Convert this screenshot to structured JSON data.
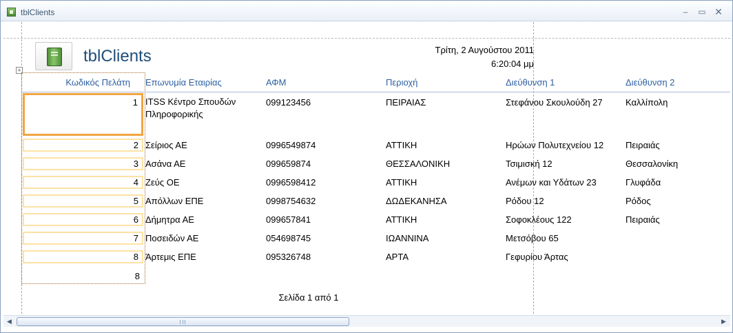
{
  "window": {
    "title": "tblClients",
    "min": "‒",
    "max": "▭",
    "close": "✕"
  },
  "report": {
    "title": "tblClients",
    "date": "Τρίτη, 2 Αυγούστου 2011",
    "time": "6:20:04 μμ",
    "columns": [
      "Κωδικός Πελάτη",
      "Επωνυμία Εταιρίας",
      "ΑΦΜ",
      "Περιοχή",
      "Διεύθυνση 1",
      "Διεύθυνση 2"
    ],
    "rows": [
      {
        "id": "1",
        "company": "ITSS Κέντρο Σπουδών Πληροφορικής",
        "afm": "099123456",
        "area": "ΠΕΙΡΑΙΑΣ",
        "address1": "Στεφάνου Σκουλούδη 27",
        "address2": "Καλλίπολη"
      },
      {
        "id": "2",
        "company": "Σείριος ΑΕ",
        "afm": "0996549874",
        "area": "ΑΤΤΙΚΗ",
        "address1": "Ηρώων Πολυτεχνείου 12",
        "address2": "Πειραιάς"
      },
      {
        "id": "3",
        "company": "Ασάνα ΑΕ",
        "afm": "099659874",
        "area": "ΘΕΣΣΑΛΟΝΙΚΗ",
        "address1": "Τσιμισκή 12",
        "address2": "Θεσσαλονίκη"
      },
      {
        "id": "4",
        "company": "Ζεύς ΟΕ",
        "afm": "0996598412",
        "area": "ΑΤΤΙΚΗ",
        "address1": "Ανέμων και Υδάτων 23",
        "address2": "Γλυφάδα"
      },
      {
        "id": "5",
        "company": "Απόλλων ΕΠΕ",
        "afm": "0998754632",
        "area": "ΔΩΔΕΚΑΝΗΣΑ",
        "address1": "Ρόδου 12",
        "address2": "Ρόδος"
      },
      {
        "id": "6",
        "company": "Δήμητρα ΑΕ",
        "afm": "099657841",
        "area": "ΑΤΤΙΚΗ",
        "address1": "Σοφοκλέους 122",
        "address2": "Πειραιάς"
      },
      {
        "id": "7",
        "company": "Ποσειδών ΑΕ",
        "afm": "054698745",
        "area": "ΙΩΑΝΝΙΝΑ",
        "address1": "Μετσόβου 65",
        "address2": ""
      },
      {
        "id": "8",
        "company": "Άρτεμις ΕΠΕ",
        "afm": "095326748",
        "area": "ΑΡΤΑ",
        "address1": "Γεφυρίου Άρτας",
        "address2": ""
      }
    ],
    "total_count": "8",
    "footer": "Σελίδα 1 από 1"
  },
  "scrollbar": {
    "left_arrow": "◀",
    "right_arrow": "▶"
  }
}
